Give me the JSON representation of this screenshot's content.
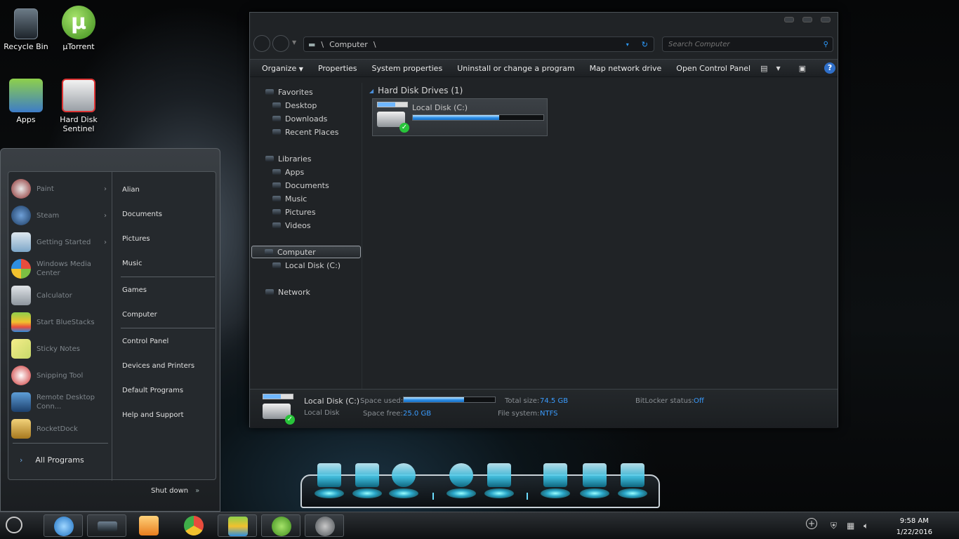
{
  "desktop": {
    "icons": [
      {
        "label": "Recycle Bin"
      },
      {
        "label": "µTorrent"
      },
      {
        "label": "Apps"
      },
      {
        "label": "Hard Disk Sentinel"
      }
    ]
  },
  "explorer": {
    "address": {
      "segments": [
        "Computer"
      ]
    },
    "search": {
      "placeholder": "Search Computer"
    },
    "toolbar": {
      "organize": "Organize",
      "properties": "Properties",
      "system_properties": "System properties",
      "uninstall": "Uninstall or change a program",
      "map_drive": "Map network drive",
      "control_panel": "Open Control Panel"
    },
    "nav": {
      "favorites": "Favorites",
      "desktop": "Desktop",
      "downloads": "Downloads",
      "recent": "Recent Places",
      "libraries": "Libraries",
      "apps": "Apps",
      "documents": "Documents",
      "music": "Music",
      "pictures": "Pictures",
      "videos": "Videos",
      "computer": "Computer",
      "local_disk": "Local Disk (C:)",
      "network": "Network"
    },
    "content": {
      "group_header": "Hard Disk Drives (1)",
      "drive_name": "Local Disk (C:)",
      "used_fraction": 0.66
    },
    "details": {
      "name": "Local Disk (C:)",
      "type": "Local Disk",
      "space_used_label": "Space used:",
      "space_free_label": "Space free:",
      "space_free": "25.0 GB",
      "total_size_label": "Total size:",
      "total_size": "74.5 GB",
      "file_system_label": "File system:",
      "file_system": "NTFS",
      "bitlocker_label": "BitLocker status:",
      "bitlocker": "Off"
    }
  },
  "start_menu": {
    "programs": [
      {
        "label": "Paint",
        "submenu": true
      },
      {
        "label": "Steam",
        "submenu": true
      },
      {
        "label": "Getting Started",
        "submenu": true
      },
      {
        "label": "Windows Media Center",
        "submenu": false
      },
      {
        "label": "Calculator",
        "submenu": false
      },
      {
        "label": "Start BlueStacks",
        "submenu": false
      },
      {
        "label": "Sticky Notes",
        "submenu": false
      },
      {
        "label": "Snipping Tool",
        "submenu": false
      },
      {
        "label": "Remote Desktop Conn...",
        "submenu": false
      },
      {
        "label": "RocketDock",
        "submenu": false
      }
    ],
    "all_programs": "All Programs",
    "right_links": {
      "user": "Alian",
      "documents": "Documents",
      "pictures": "Pictures",
      "music": "Music",
      "games": "Games",
      "computer": "Computer",
      "control_panel": "Control Panel",
      "devices": "Devices and Printers",
      "default_programs": "Default Programs",
      "help": "Help and Support"
    },
    "shutdown": "Shut down"
  },
  "taskbar": {
    "time": "9:58 AM",
    "date": "1/22/2016"
  }
}
